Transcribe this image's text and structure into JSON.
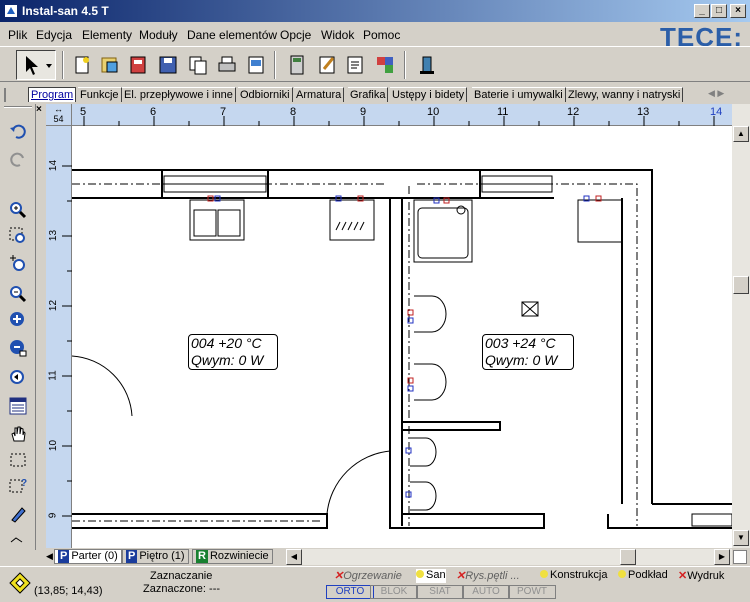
{
  "window": {
    "title": "Instal-san 4.5 T",
    "controls": {
      "minimize": "_",
      "maximize": "□",
      "close": "×"
    }
  },
  "menu": [
    "Plik",
    "Edycja",
    "Elementy",
    "Moduły",
    "Dane elementów",
    "Opcje",
    "Widok",
    "Pomoc"
  ],
  "brand": "TECE:",
  "tabs": [
    "Program",
    "Funkcje",
    "El. przepływowe i inne",
    "Odbiorniki",
    "Armatura",
    "Grafika",
    "Ustępy i bidety",
    "Baterie i umywalki",
    "Zlewy, wanny i natryski"
  ],
  "ruler": {
    "corner": "54",
    "top": [
      "5",
      "6",
      "7",
      "8",
      "9",
      "10",
      "11",
      "12",
      "13",
      "14"
    ],
    "left": [
      "14",
      "13",
      "12",
      "11",
      "10",
      "9"
    ]
  },
  "rooms": [
    {
      "line1": "004 +20 °C",
      "line2": "Qwym: 0 W"
    },
    {
      "line1": "003 +24 °C",
      "line2": "Qwym: 0 W"
    }
  ],
  "floors": [
    {
      "badge": "P",
      "label": "Parter (0)"
    },
    {
      "badge": "P",
      "label": "Piętro (1)"
    },
    {
      "badge": "R",
      "label": "Rozwiniecie"
    }
  ],
  "status": {
    "coords": "(13,85; 14,43)",
    "selecting": "Zaznaczanie",
    "selected": "Zaznaczone: ---",
    "layers": [
      "Ogrzewanie",
      "San",
      "Rys.pętli ...",
      "Konstrukcja",
      "Podkład",
      "Wydruk"
    ],
    "modes": [
      "ORTO",
      "BLOK",
      "SIAT",
      "AUTO",
      "POWT"
    ]
  }
}
